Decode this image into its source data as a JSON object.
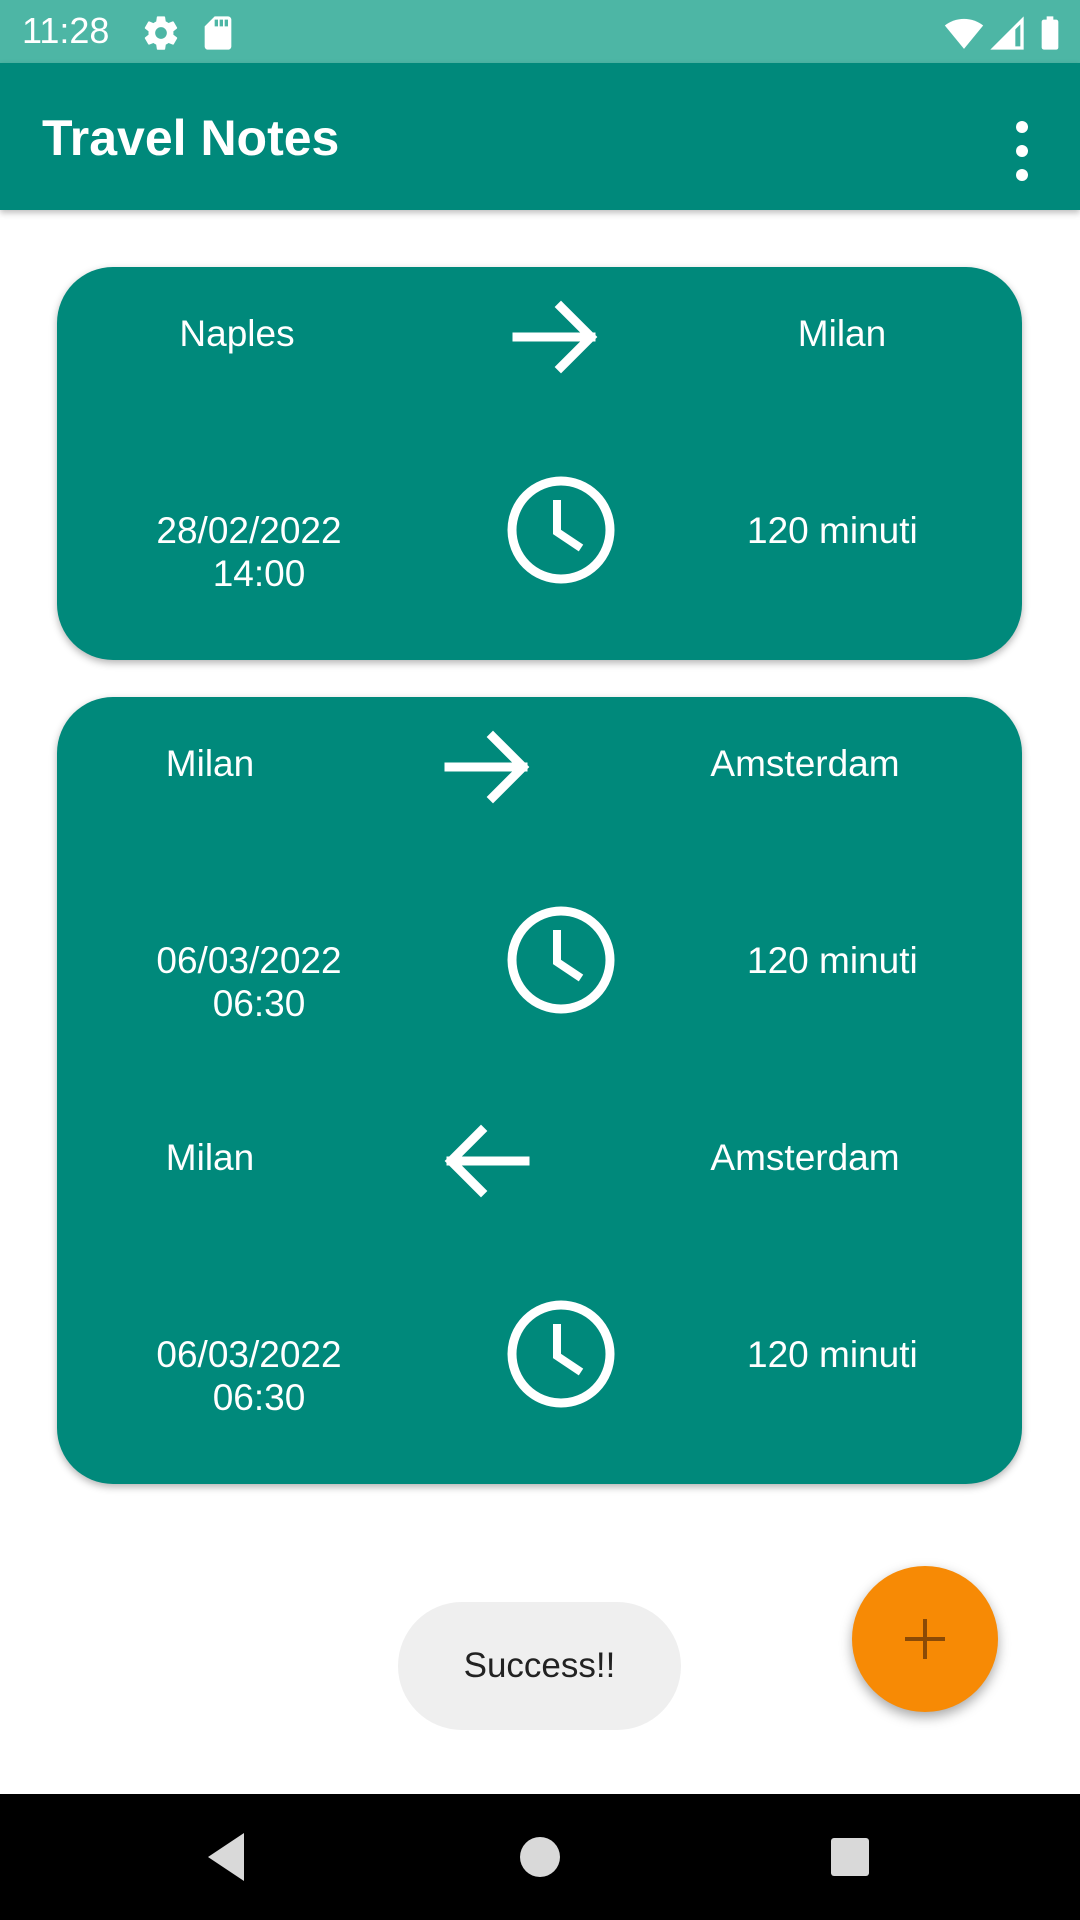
{
  "status_bar": {
    "time": "11:28",
    "left_icons": [
      "gear-icon",
      "sd-card-icon"
    ],
    "right_icons": [
      "wifi-icon",
      "signal-icon",
      "battery-icon"
    ]
  },
  "app_bar": {
    "title": "Travel Notes",
    "overflow_icon": "more-vert-icon"
  },
  "trips": [
    {
      "legs": [
        {
          "from": "Naples",
          "to": "Milan",
          "direction": "right",
          "date": "28/02/2022",
          "time": "14:00",
          "duration": "120 minuti"
        }
      ]
    },
    {
      "legs": [
        {
          "from": "Milan",
          "to": "Amsterdam",
          "direction": "right",
          "date": "06/03/2022",
          "time": "06:30",
          "duration": "120 minuti"
        },
        {
          "from": "Milan",
          "to": "Amsterdam",
          "direction": "left",
          "date": "06/03/2022",
          "time": "06:30",
          "duration": "120 minuti"
        }
      ]
    }
  ],
  "toast": {
    "text": "Success!!"
  },
  "fab": {
    "icon": "plus-icon"
  },
  "colors": {
    "primary": "#00897B",
    "status_bar": "#4DB6A5",
    "accent": "#F78A05",
    "toast_bg": "#EFEFEF",
    "nav_bar": "#000000"
  }
}
